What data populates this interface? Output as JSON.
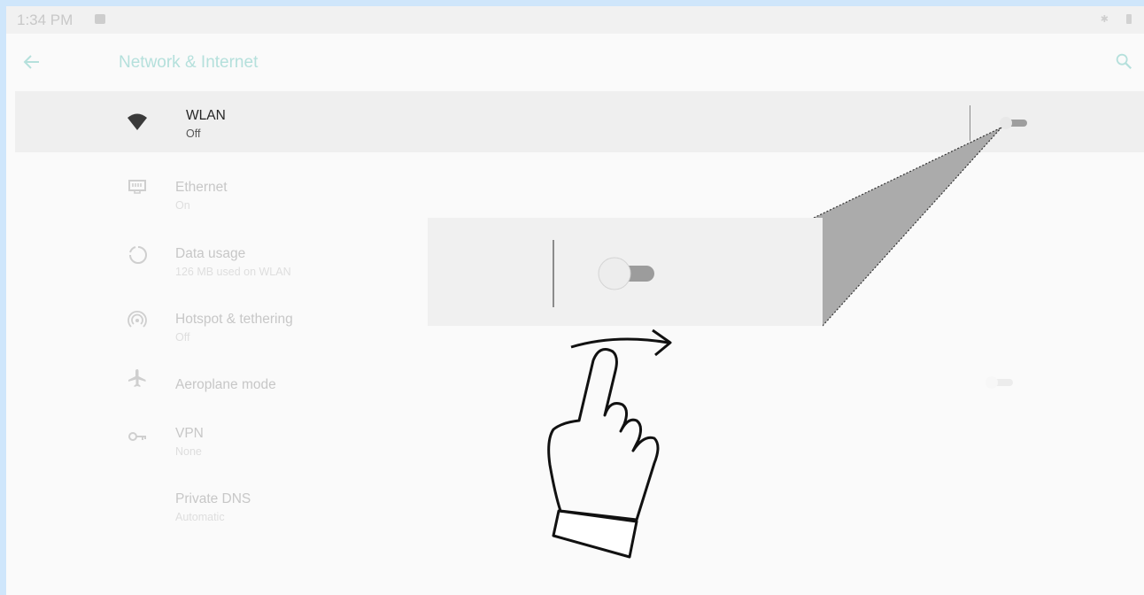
{
  "status_bar": {
    "time": "1:34 PM",
    "icons": [
      "image-notification-icon",
      "bluetooth-icon",
      "battery-icon"
    ]
  },
  "app_bar": {
    "title": "Network & Internet",
    "back_icon": "back-arrow-icon",
    "search_icon": "search-icon"
  },
  "settings": {
    "items": [
      {
        "title": "WLAN",
        "subtitle": "Off",
        "icon": "wifi-icon",
        "toggle": "off"
      },
      {
        "title": "Ethernet",
        "subtitle": "On",
        "icon": "ethernet-icon"
      },
      {
        "title": "Data usage",
        "subtitle": "126 MB used on WLAN",
        "icon": "data-usage-icon"
      },
      {
        "title": "Hotspot & tethering",
        "subtitle": "Off",
        "icon": "hotspot-icon"
      },
      {
        "title": "Aeroplane mode",
        "subtitle": "",
        "icon": "airplane-icon",
        "toggle": "off"
      },
      {
        "title": "VPN",
        "subtitle": "None",
        "icon": "vpn-key-icon"
      },
      {
        "title": "Private DNS",
        "subtitle": "Automatic",
        "icon": ""
      }
    ]
  },
  "annotation": {
    "zoom_callout": "magnified WLAN toggle switch",
    "gesture": "swipe-right-hand-icon"
  },
  "colors": {
    "accent": "#b5e0dc",
    "background": "#fafafa",
    "highlight_row": "#efefef",
    "frame": "#cfe6fb"
  }
}
